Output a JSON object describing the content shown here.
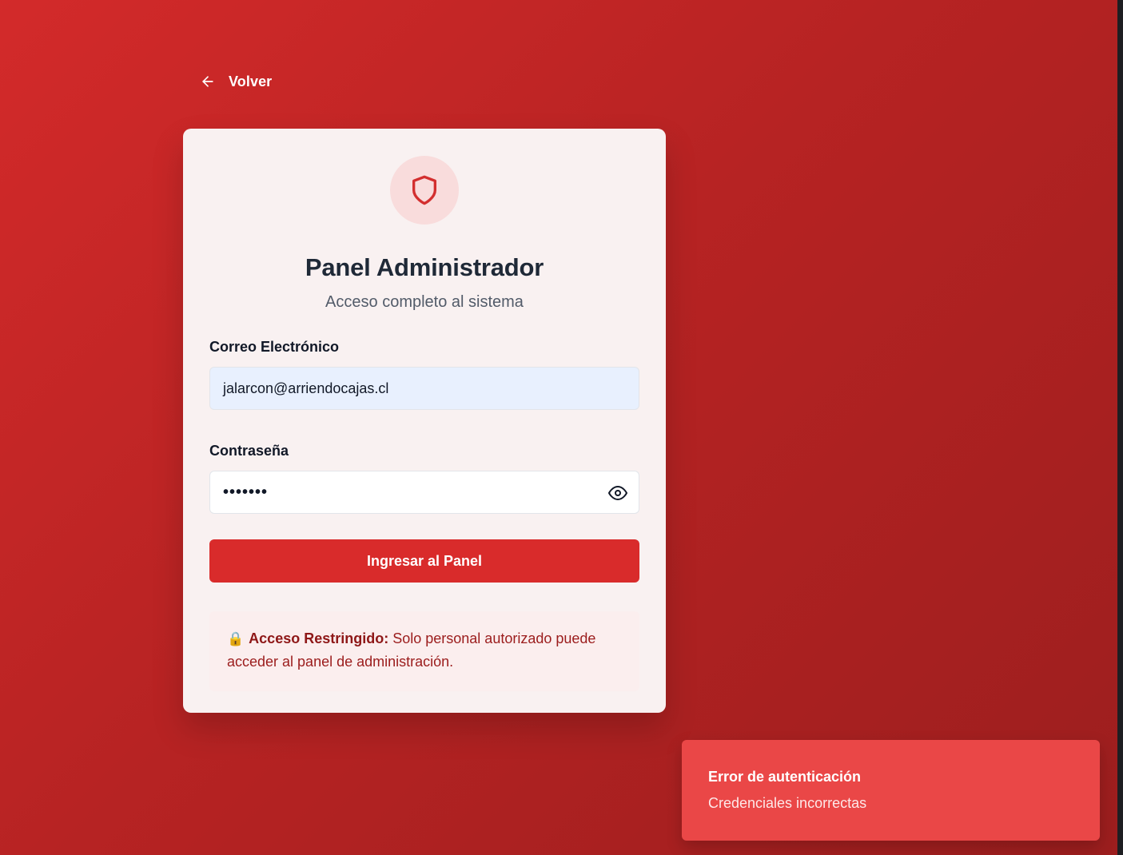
{
  "back": {
    "label": "Volver",
    "icon": "arrow-left-icon"
  },
  "login": {
    "icon": "shield-icon",
    "title": "Panel Administrador",
    "subtitle": "Acceso completo al sistema",
    "email": {
      "label": "Correo Electrónico",
      "value": "jalarcon@arriendocajas.cl"
    },
    "password": {
      "label": "Contraseña",
      "masked_value": "•••••••",
      "toggle_icon": "eye-icon"
    },
    "submit_label": "Ingresar al Panel",
    "notice": {
      "icon": "🔒",
      "strong": "Acceso Restringido:",
      "text": "Solo personal autorizado puede acceder al panel de administración."
    }
  },
  "toast": {
    "title": "Error de autenticación",
    "message": "Credenciales incorrectas"
  },
  "colors": {
    "background_start": "#d32a2a",
    "background_end": "#9c1e1e",
    "primary_button": "#d92b2b",
    "toast_background": "#ea4747",
    "card_background": "#f9f1f1"
  }
}
